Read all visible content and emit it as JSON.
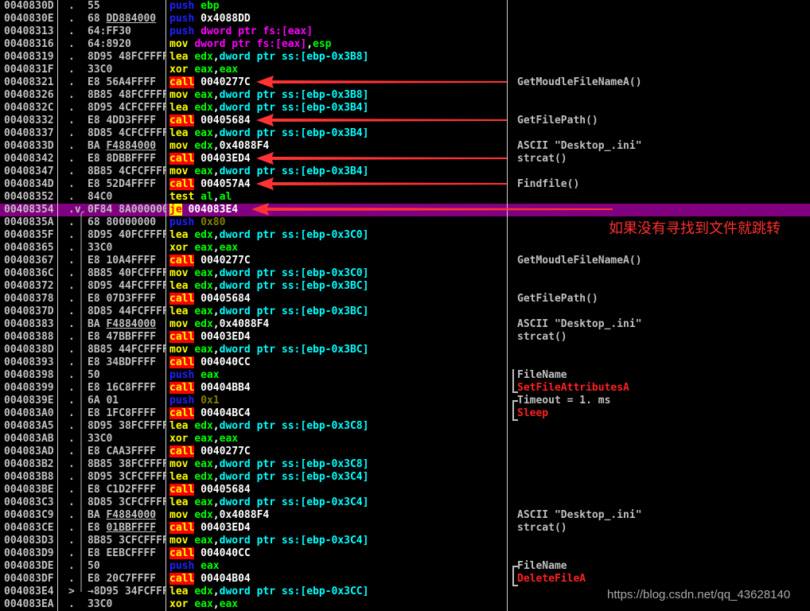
{
  "colors": {
    "background": "#000000",
    "selected_row": "#800080",
    "arrow": "#ff3333",
    "call_badge": "#ff0000",
    "api_comment": "#ff2020"
  },
  "selected_row_index": 16,
  "rows": [
    {
      "addr": "0040830D",
      "mark": ".",
      "hex": "55",
      "asm": "push ebp",
      "comment": ""
    },
    {
      "addr": "0040830E",
      "mark": ".",
      "hex": "68 DD884000",
      "asm": "push 0x4088DD",
      "comment": ""
    },
    {
      "addr": "00408313",
      "mark": ".",
      "hex": "64:FF30",
      "asm": "push dword ptr fs:[eax]",
      "comment": ""
    },
    {
      "addr": "00408316",
      "mark": ".",
      "hex": "64:8920",
      "asm": "mov dword ptr fs:[eax],esp",
      "comment": ""
    },
    {
      "addr": "00408319",
      "mark": ".",
      "hex": "8D95 48FCFFFF",
      "asm": "lea edx,dword ptr ss:[ebp-0x3B8]",
      "comment": ""
    },
    {
      "addr": "0040831F",
      "mark": ".",
      "hex": "33C0",
      "asm": "xor eax,eax",
      "comment": ""
    },
    {
      "addr": "00408321",
      "mark": ".",
      "hex": "E8 56A4FFFF",
      "asm": "call 0040277C",
      "comment": "GetMoudleFileNameA()"
    },
    {
      "addr": "00408326",
      "mark": ".",
      "hex": "8B85 48FCFFFF",
      "asm": "mov eax,dword ptr ss:[ebp-0x3B8]",
      "comment": ""
    },
    {
      "addr": "0040832C",
      "mark": ".",
      "hex": "8D95 4CFCFFFF",
      "asm": "lea edx,dword ptr ss:[ebp-0x3B4]",
      "comment": ""
    },
    {
      "addr": "00408332",
      "mark": ".",
      "hex": "E8 4DD3FFFF",
      "asm": "call 00405684",
      "comment": "GetFilePath()"
    },
    {
      "addr": "00408337",
      "mark": ".",
      "hex": "8D85 4CFCFFFF",
      "asm": "lea eax,dword ptr ss:[ebp-0x3B4]",
      "comment": ""
    },
    {
      "addr": "0040833D",
      "mark": ".",
      "hex": "BA F4884000",
      "asm": "mov edx,0x4088F4",
      "comment": "ASCII \"Desktop_.ini\""
    },
    {
      "addr": "00408342",
      "mark": ".",
      "hex": "E8 8DBBFFFF",
      "asm": "call 00403ED4",
      "comment": "strcat()"
    },
    {
      "addr": "00408347",
      "mark": ".",
      "hex": "8B85 4CFCFFFF",
      "asm": "mov eax,dword ptr ss:[ebp-0x3B4]",
      "comment": ""
    },
    {
      "addr": "0040834D",
      "mark": ".",
      "hex": "E8 52D4FFFF",
      "asm": "call 004057A4",
      "comment": "Findfile()"
    },
    {
      "addr": "00408352",
      "mark": ".",
      "hex": "84C0",
      "asm": "test al,al",
      "comment": ""
    },
    {
      "addr": "00408354",
      "mark": ".v",
      "hex": "0F84 8A000000",
      "asm": "je 004083E4",
      "comment": ""
    },
    {
      "addr": "0040835A",
      "mark": ".",
      "hex": "68 80000000",
      "asm": "push 0x80",
      "comment": ""
    },
    {
      "addr": "0040835F",
      "mark": ".",
      "hex": "8D95 40FCFFFF",
      "asm": "lea edx,dword ptr ss:[ebp-0x3C0]",
      "comment": ""
    },
    {
      "addr": "00408365",
      "mark": ".",
      "hex": "33C0",
      "asm": "xor eax,eax",
      "comment": ""
    },
    {
      "addr": "00408367",
      "mark": ".",
      "hex": "E8 10A4FFFF",
      "asm": "call 0040277C",
      "comment": "GetMoudleFileNameA()"
    },
    {
      "addr": "0040836C",
      "mark": ".",
      "hex": "8B85 40FCFFFF",
      "asm": "mov eax,dword ptr ss:[ebp-0x3C0]",
      "comment": ""
    },
    {
      "addr": "00408372",
      "mark": ".",
      "hex": "8D95 44FCFFFF",
      "asm": "lea edx,dword ptr ss:[ebp-0x3BC]",
      "comment": ""
    },
    {
      "addr": "00408378",
      "mark": ".",
      "hex": "E8 07D3FFFF",
      "asm": "call 00405684",
      "comment": "GetFilePath()"
    },
    {
      "addr": "0040837D",
      "mark": ".",
      "hex": "8D85 44FCFFFF",
      "asm": "lea eax,dword ptr ss:[ebp-0x3BC]",
      "comment": ""
    },
    {
      "addr": "00408383",
      "mark": ".",
      "hex": "BA F4884000",
      "asm": "mov edx,0x4088F4",
      "comment": "ASCII \"Desktop_.ini\""
    },
    {
      "addr": "00408388",
      "mark": ".",
      "hex": "E8 47BBFFFF",
      "asm": "call 00403ED4",
      "comment": "strcat()"
    },
    {
      "addr": "0040838D",
      "mark": ".",
      "hex": "8B85 44FCFFFF",
      "asm": "mov eax,dword ptr ss:[ebp-0x3BC]",
      "comment": ""
    },
    {
      "addr": "00408393",
      "mark": ".",
      "hex": "E8 34BDFFFF",
      "asm": "call 004040CC",
      "comment": ""
    },
    {
      "addr": "00408398",
      "mark": ".",
      "hex": "50",
      "asm": "push eax",
      "comment": "FileName"
    },
    {
      "addr": "00408399",
      "mark": ".",
      "hex": "E8 16C8FFFF",
      "asm": "call 00404BB4",
      "comment": "SetFileAttributesA",
      "api": true
    },
    {
      "addr": "0040839E",
      "mark": ".",
      "hex": "6A 01",
      "asm": "push 0x1",
      "comment": "Timeout = 1. ms"
    },
    {
      "addr": "004083A0",
      "mark": ".",
      "hex": "E8 1FC8FFFF",
      "asm": "call 00404BC4",
      "comment": "Sleep",
      "api": true
    },
    {
      "addr": "004083A5",
      "mark": ".",
      "hex": "8D95 38FCFFFF",
      "asm": "lea edx,dword ptr ss:[ebp-0x3C8]",
      "comment": ""
    },
    {
      "addr": "004083AB",
      "mark": ".",
      "hex": "33C0",
      "asm": "xor eax,eax",
      "comment": ""
    },
    {
      "addr": "004083AD",
      "mark": ".",
      "hex": "E8 CAA3FFFF",
      "asm": "call 0040277C",
      "comment": ""
    },
    {
      "addr": "004083B2",
      "mark": ".",
      "hex": "8B85 38FCFFFF",
      "asm": "mov eax,dword ptr ss:[ebp-0x3C8]",
      "comment": ""
    },
    {
      "addr": "004083B8",
      "mark": ".",
      "hex": "8D95 3CFCFFFF",
      "asm": "lea edx,dword ptr ss:[ebp-0x3C4]",
      "comment": ""
    },
    {
      "addr": "004083BE",
      "mark": ".",
      "hex": "E8 C1D2FFFF",
      "asm": "call 00405684",
      "comment": ""
    },
    {
      "addr": "004083C3",
      "mark": ".",
      "hex": "8D85 3CFCFFFF",
      "asm": "lea eax,dword ptr ss:[ebp-0x3C4]",
      "comment": ""
    },
    {
      "addr": "004083C9",
      "mark": ".",
      "hex": "BA F4884000",
      "asm": "mov edx,0x4088F4",
      "comment": "ASCII \"Desktop_.ini\""
    },
    {
      "addr": "004083CE",
      "mark": ".",
      "hex": "E8 01BBFFFF",
      "asm": "call 00403ED4",
      "comment": "strcat()"
    },
    {
      "addr": "004083D3",
      "mark": ".",
      "hex": "8B85 3CFCFFFF",
      "asm": "mov eax,dword ptr ss:[ebp-0x3C4]",
      "comment": ""
    },
    {
      "addr": "004083D9",
      "mark": ".",
      "hex": "E8 EEBCFFFF",
      "asm": "call 004040CC",
      "comment": ""
    },
    {
      "addr": "004083DE",
      "mark": ".",
      "hex": "50",
      "asm": "push eax",
      "comment": "FileName"
    },
    {
      "addr": "004083DF",
      "mark": ".",
      "hex": "E8 20C7FFFF",
      "asm": "call 00404B04",
      "comment": "DeleteFileA",
      "api": true
    },
    {
      "addr": "004083E4",
      "mark": ">",
      "hex": "→8D95 34FCFFFF",
      "asm": "lea edx,dword ptr ss:[ebp-0x3CC]",
      "comment": ""
    },
    {
      "addr": "004083EA",
      "mark": ".",
      "hex": "33C0",
      "asm": "xor eax,eax",
      "comment": ""
    }
  ],
  "underlined_hex_rows": [
    1,
    11,
    25,
    40,
    41
  ],
  "arrow_rows": [
    6,
    9,
    12,
    14,
    16
  ],
  "jump": {
    "from_row": 16,
    "to_row": 46
  },
  "annotation": "如果没有寻找到文件就跳转",
  "watermark": "https://blog.csdn.net/qq_43628140"
}
